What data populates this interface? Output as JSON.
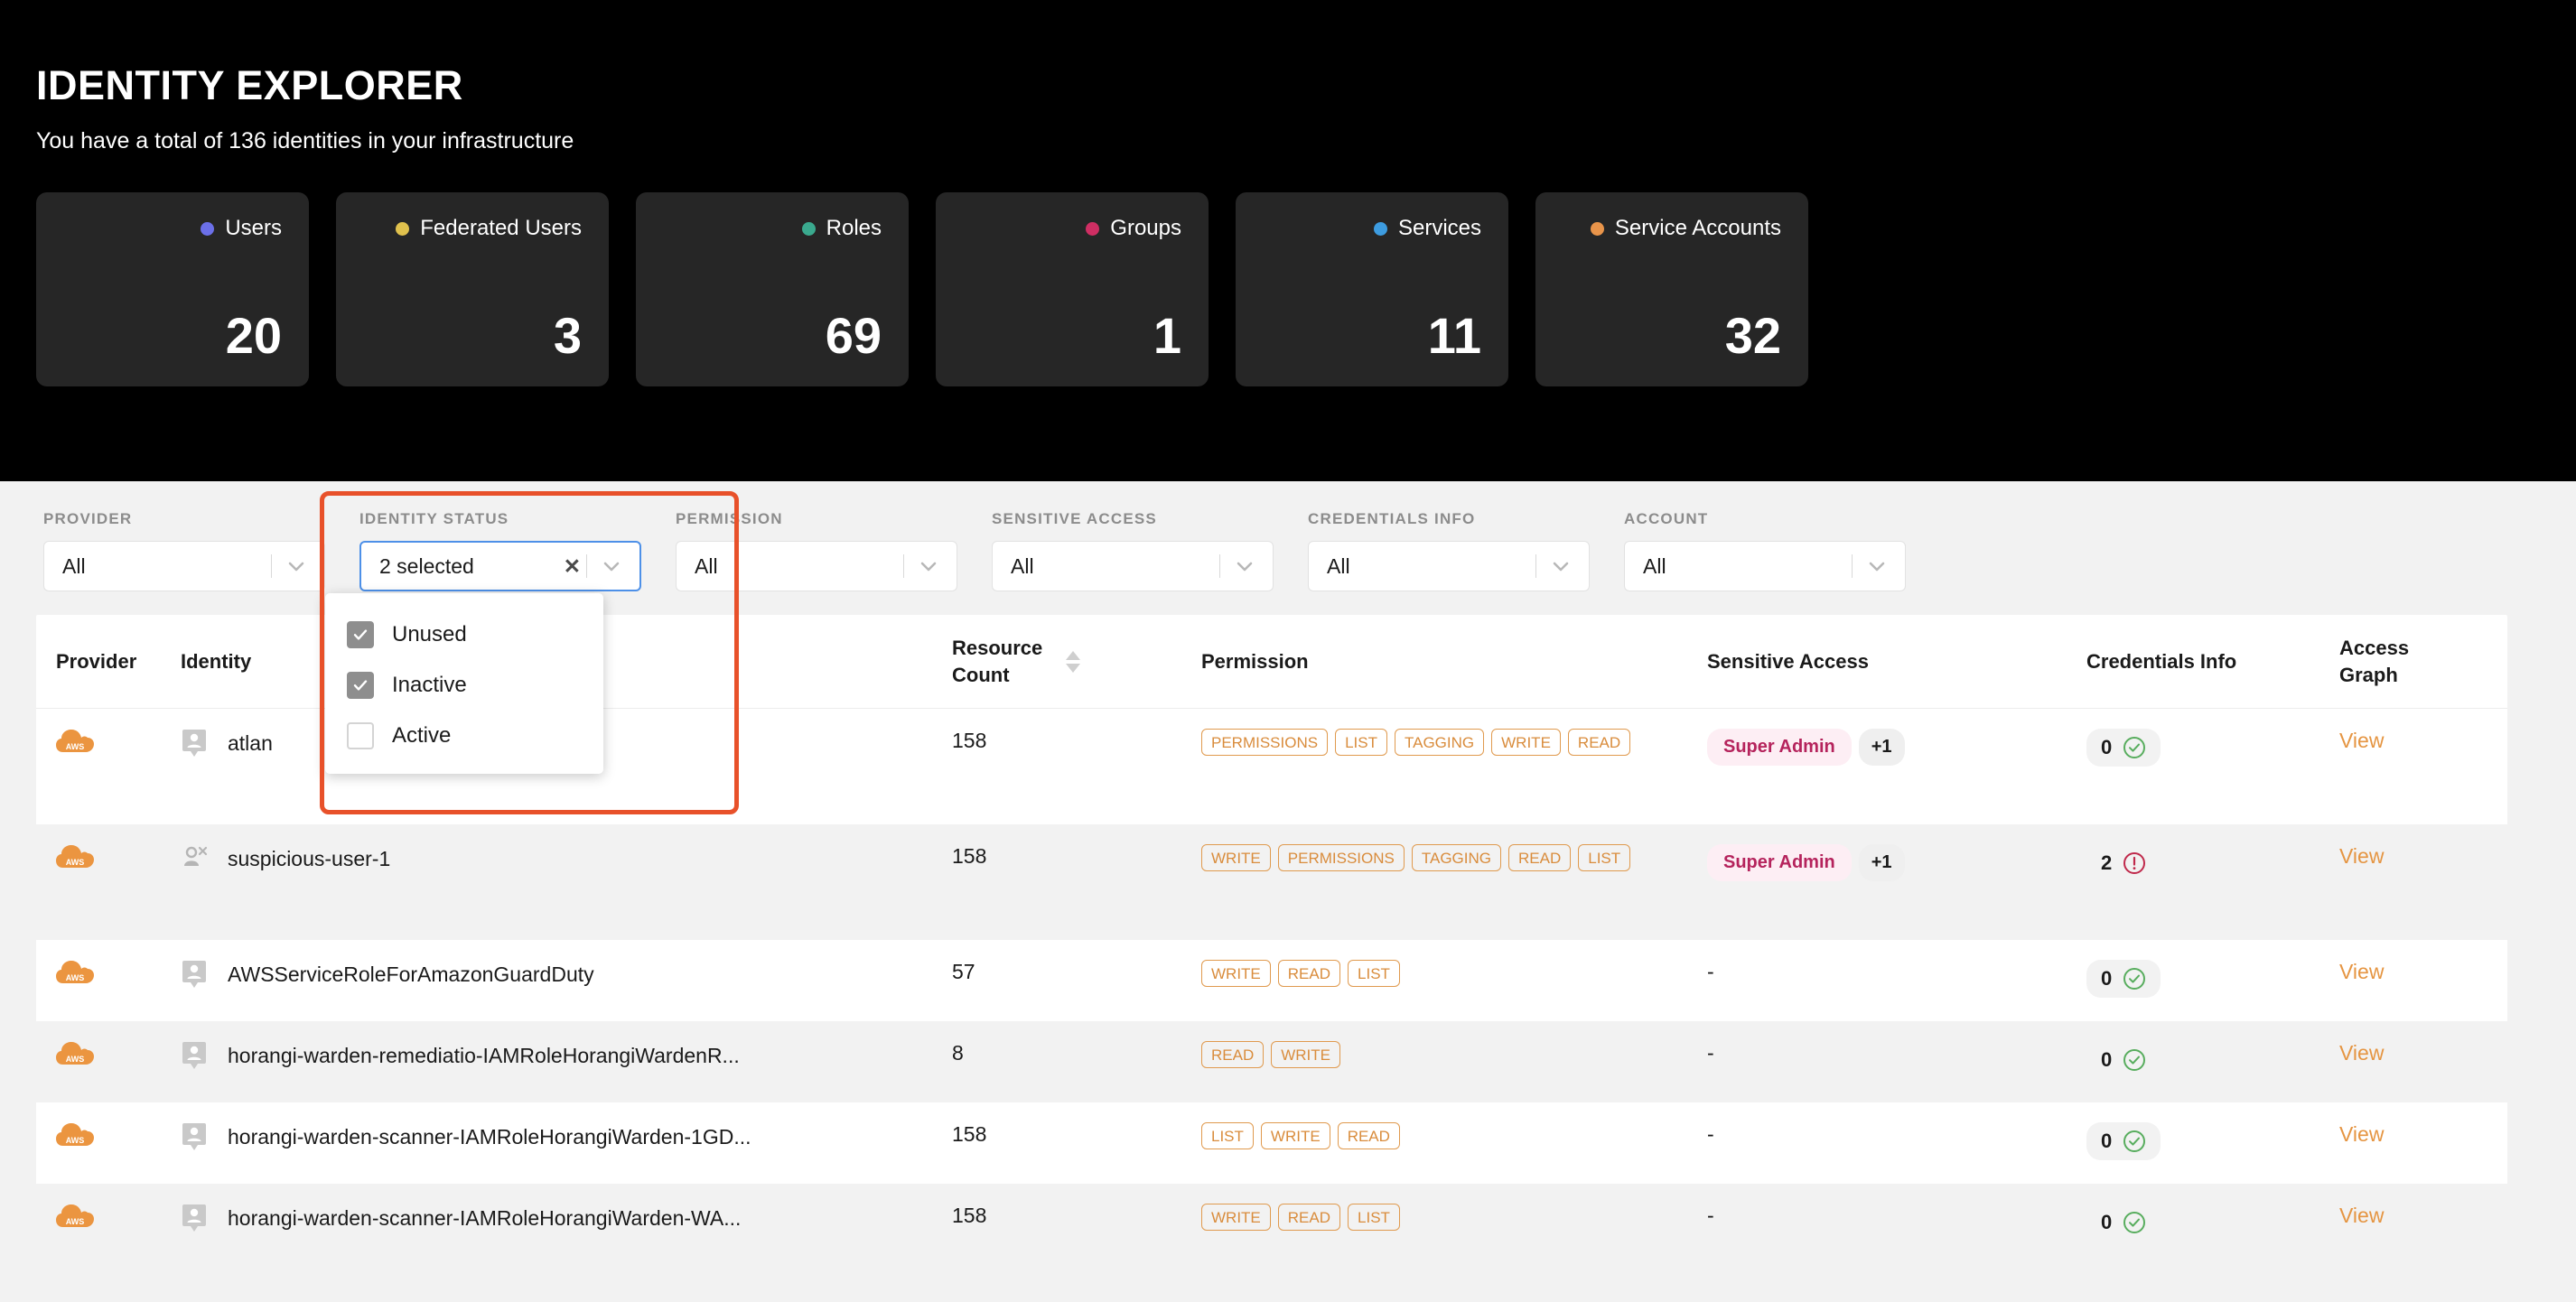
{
  "hero": {
    "title": "IDENTITY EXPLORER",
    "subtitle": "You have a total of 136 identities in your infrastructure",
    "stats": [
      {
        "label": "Users",
        "value": "20",
        "color": "#6b6fe8"
      },
      {
        "label": "Federated Users",
        "value": "3",
        "color": "#e0c14d"
      },
      {
        "label": "Roles",
        "value": "69",
        "color": "#3aa98e"
      },
      {
        "label": "Groups",
        "value": "1",
        "color": "#cf2e63"
      },
      {
        "label": "Services",
        "value": "11",
        "color": "#3d9ce0"
      },
      {
        "label": "Service Accounts",
        "value": "32",
        "color": "#e8944a"
      }
    ]
  },
  "filters": [
    {
      "label": "PROVIDER",
      "value": "All",
      "has_clear": false,
      "active": false
    },
    {
      "label": "IDENTITY STATUS",
      "value": "2 selected",
      "has_clear": true,
      "active": true
    },
    {
      "label": "PERMISSION",
      "value": "All",
      "has_clear": false,
      "active": false
    },
    {
      "label": "SENSITIVE ACCESS",
      "value": "All",
      "has_clear": false,
      "active": false
    },
    {
      "label": "CREDENTIALS INFO",
      "value": "All",
      "has_clear": false,
      "active": false
    },
    {
      "label": "ACCOUNT",
      "value": "All",
      "has_clear": false,
      "active": false
    }
  ],
  "dropdown": {
    "open_for": "IDENTITY STATUS",
    "options": [
      {
        "label": "Unused",
        "checked": true
      },
      {
        "label": "Inactive",
        "checked": true
      },
      {
        "label": "Active",
        "checked": false
      }
    ]
  },
  "table": {
    "columns": {
      "provider": "Provider",
      "identity": "Identity",
      "resource_count_l1": "Resource",
      "resource_count_l2": "Count",
      "permission": "Permission",
      "sensitive_access": "Sensitive Access",
      "credentials_info": "Credentials Info",
      "access_graph_l1": "Access",
      "access_graph_l2": "Graph"
    },
    "view_label": "View",
    "rows": [
      {
        "provider": "AWS",
        "identity": "atlan",
        "identity_icon": "user-card-icon",
        "resource_count": "158",
        "permissions": [
          "PERMISSIONS",
          "LIST",
          "TAGGING",
          "WRITE",
          "READ"
        ],
        "sensitive_access": "Super Admin",
        "sensitive_more": "+1",
        "credentials_count": "0",
        "credentials_status": "ok"
      },
      {
        "provider": "AWS",
        "identity": "suspicious-user-1",
        "identity_icon": "user-removed-icon",
        "resource_count": "158",
        "permissions": [
          "WRITE",
          "PERMISSIONS",
          "TAGGING",
          "READ",
          "LIST"
        ],
        "sensitive_access": "Super Admin",
        "sensitive_more": "+1",
        "credentials_count": "2",
        "credentials_status": "alert"
      },
      {
        "provider": "AWS",
        "identity": "AWSServiceRoleForAmazonGuardDuty",
        "identity_icon": "user-card-icon",
        "resource_count": "57",
        "permissions": [
          "WRITE",
          "READ",
          "LIST"
        ],
        "sensitive_access": "-",
        "sensitive_more": "",
        "credentials_count": "0",
        "credentials_status": "ok"
      },
      {
        "provider": "AWS",
        "identity": "horangi-warden-remediatio-IAMRoleHorangiWardenR...",
        "identity_icon": "user-card-icon",
        "resource_count": "8",
        "permissions": [
          "READ",
          "WRITE"
        ],
        "sensitive_access": "-",
        "sensitive_more": "",
        "credentials_count": "0",
        "credentials_status": "ok"
      },
      {
        "provider": "AWS",
        "identity": "horangi-warden-scanner-IAMRoleHorangiWarden-1GD...",
        "identity_icon": "user-card-icon",
        "resource_count": "158",
        "permissions": [
          "LIST",
          "WRITE",
          "READ"
        ],
        "sensitive_access": "-",
        "sensitive_more": "",
        "credentials_count": "0",
        "credentials_status": "ok"
      },
      {
        "provider": "AWS",
        "identity": "horangi-warden-scanner-IAMRoleHorangiWarden-WA...",
        "identity_icon": "user-card-icon",
        "resource_count": "158",
        "permissions": [
          "WRITE",
          "READ",
          "LIST"
        ],
        "sensitive_access": "-",
        "sensitive_more": "",
        "credentials_count": "0",
        "credentials_status": "ok"
      }
    ]
  }
}
